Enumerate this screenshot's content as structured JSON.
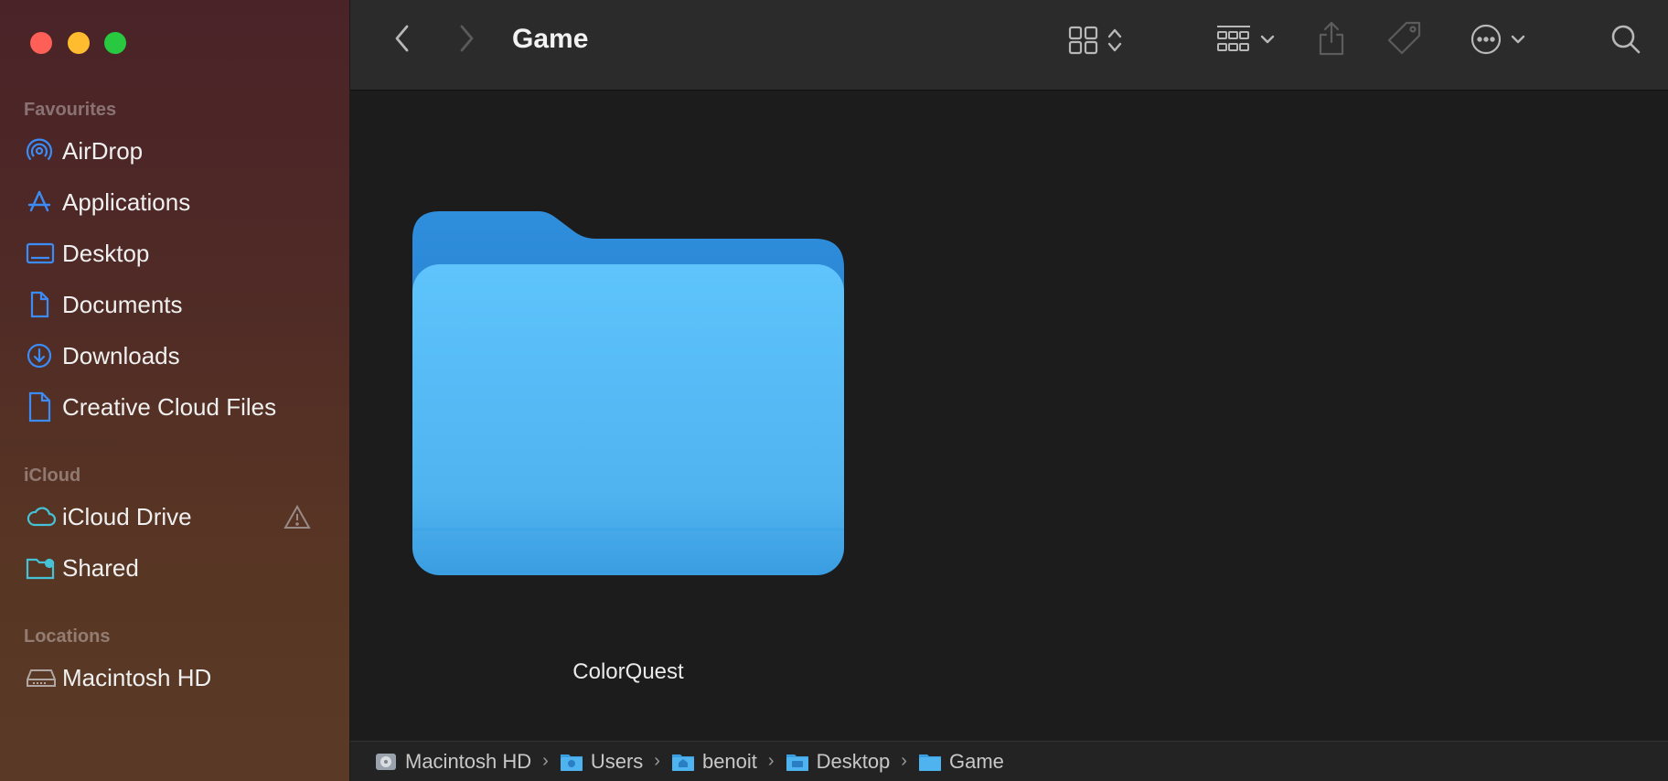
{
  "window": {
    "title": "Game"
  },
  "sidebar": {
    "favourites_title": "Favourites",
    "favourites": [
      {
        "label": "AirDrop",
        "icon": "airdrop-icon"
      },
      {
        "label": "Applications",
        "icon": "applications-icon"
      },
      {
        "label": "Desktop",
        "icon": "desktop-icon"
      },
      {
        "label": "Documents",
        "icon": "document-icon"
      },
      {
        "label": "Downloads",
        "icon": "download-icon"
      },
      {
        "label": "Creative Cloud Files",
        "icon": "file-icon"
      }
    ],
    "icloud_title": "iCloud",
    "icloud": [
      {
        "label": "iCloud Drive",
        "icon": "cloud-icon",
        "badge": "warning-icon"
      },
      {
        "label": "Shared",
        "icon": "shared-folder-icon"
      }
    ],
    "locations_title": "Locations",
    "locations": [
      {
        "label": "Macintosh HD",
        "icon": "harddrive-icon"
      }
    ]
  },
  "content": {
    "items": [
      {
        "name": "ColorQuest",
        "kind": "folder"
      }
    ]
  },
  "pathbar": {
    "crumbs": [
      "Macintosh HD",
      "Users",
      "benoit",
      "Desktop",
      "Game"
    ]
  },
  "colors": {
    "accent": "#3b82f6",
    "folder": "#4fb3f0"
  }
}
